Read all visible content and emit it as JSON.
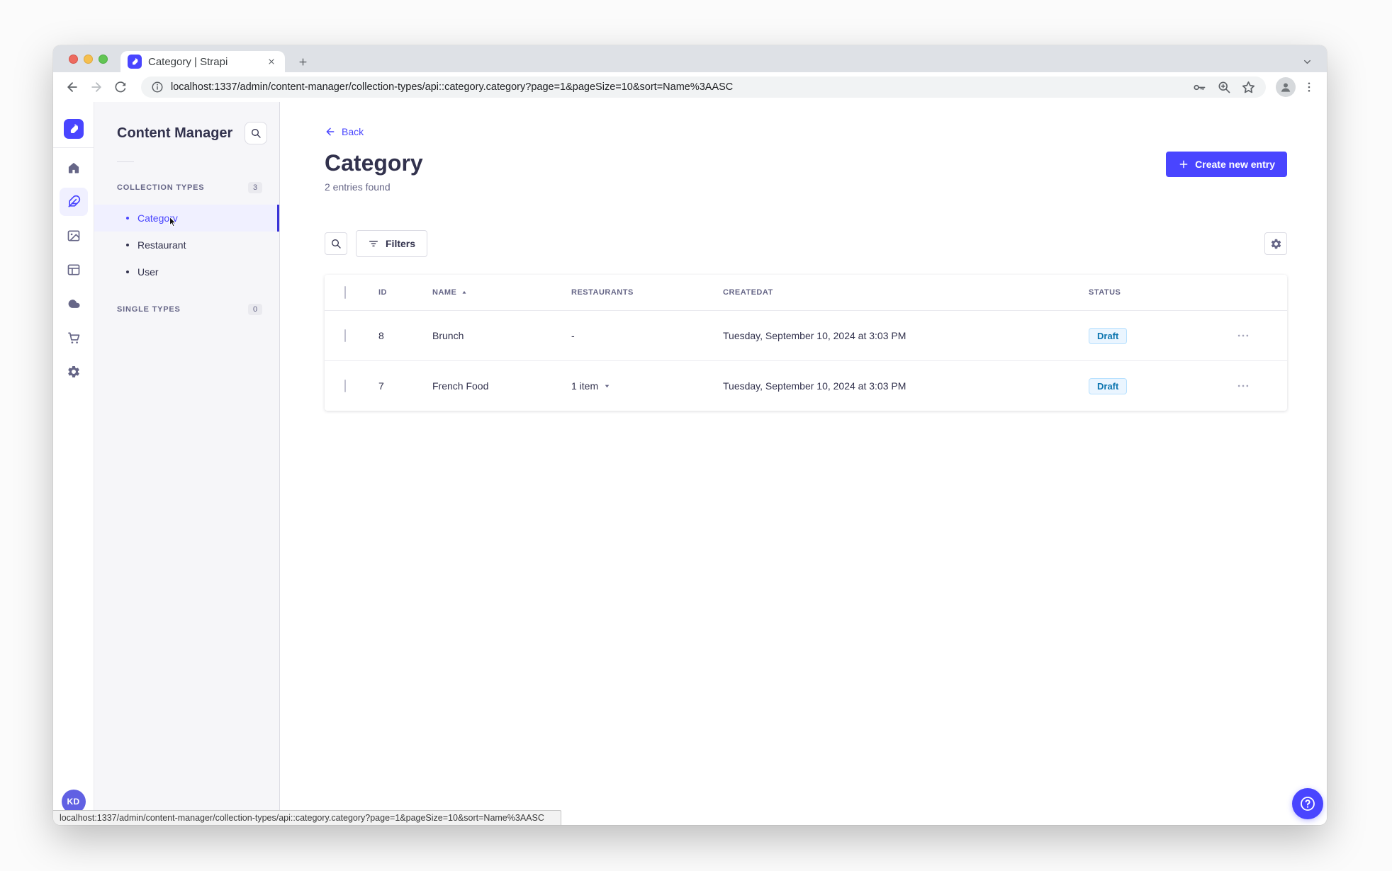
{
  "browser": {
    "tab_title": "Category | Strapi",
    "url": "localhost:1337/admin/content-manager/collection-types/api::category.category?page=1&pageSize=10&sort=Name%3AASC",
    "status_url": "localhost:1337/admin/content-manager/collection-types/api::category.category?page=1&pageSize=10&sort=Name%3AASC"
  },
  "rail": {
    "avatar_initials": "KD",
    "icons": [
      "strapi-logo",
      "home",
      "content-manager-feather",
      "media-library-image",
      "content-type-builder-layout",
      "cloud",
      "marketplace-cart",
      "settings-gear"
    ]
  },
  "sidebar": {
    "title": "Content Manager",
    "collection_section": {
      "label": "COLLECTION TYPES",
      "count": "3"
    },
    "items": [
      {
        "label": "Category"
      },
      {
        "label": "Restaurant"
      },
      {
        "label": "User"
      }
    ],
    "single_section": {
      "label": "SINGLE TYPES",
      "count": "0"
    }
  },
  "main": {
    "back_label": "Back",
    "title": "Category",
    "subtitle": "2 entries found",
    "create_button": "Create new entry",
    "filters_button": "Filters"
  },
  "table": {
    "headers": {
      "id": "ID",
      "name": "NAME",
      "restaurants": "RESTAURANTS",
      "createdat": "CREATEDAT",
      "status": "STATUS"
    },
    "rows": [
      {
        "id": "8",
        "name": "Brunch",
        "restaurants": "-",
        "createdat": "Tuesday, September 10, 2024 at 3:03 PM",
        "status": "Draft"
      },
      {
        "id": "7",
        "name": "French Food",
        "restaurants": "1 item",
        "createdat": "Tuesday, September 10, 2024 at 3:03 PM",
        "status": "Draft"
      }
    ]
  },
  "colors": {
    "primary": "#4945ff",
    "primary_light_bg": "#f0f0ff",
    "draft_bg": "#eaf5ff",
    "draft_border": "#b8e1ff",
    "draft_text": "#0c75af",
    "text_dark": "#32324d",
    "text_muted": "#666687"
  }
}
